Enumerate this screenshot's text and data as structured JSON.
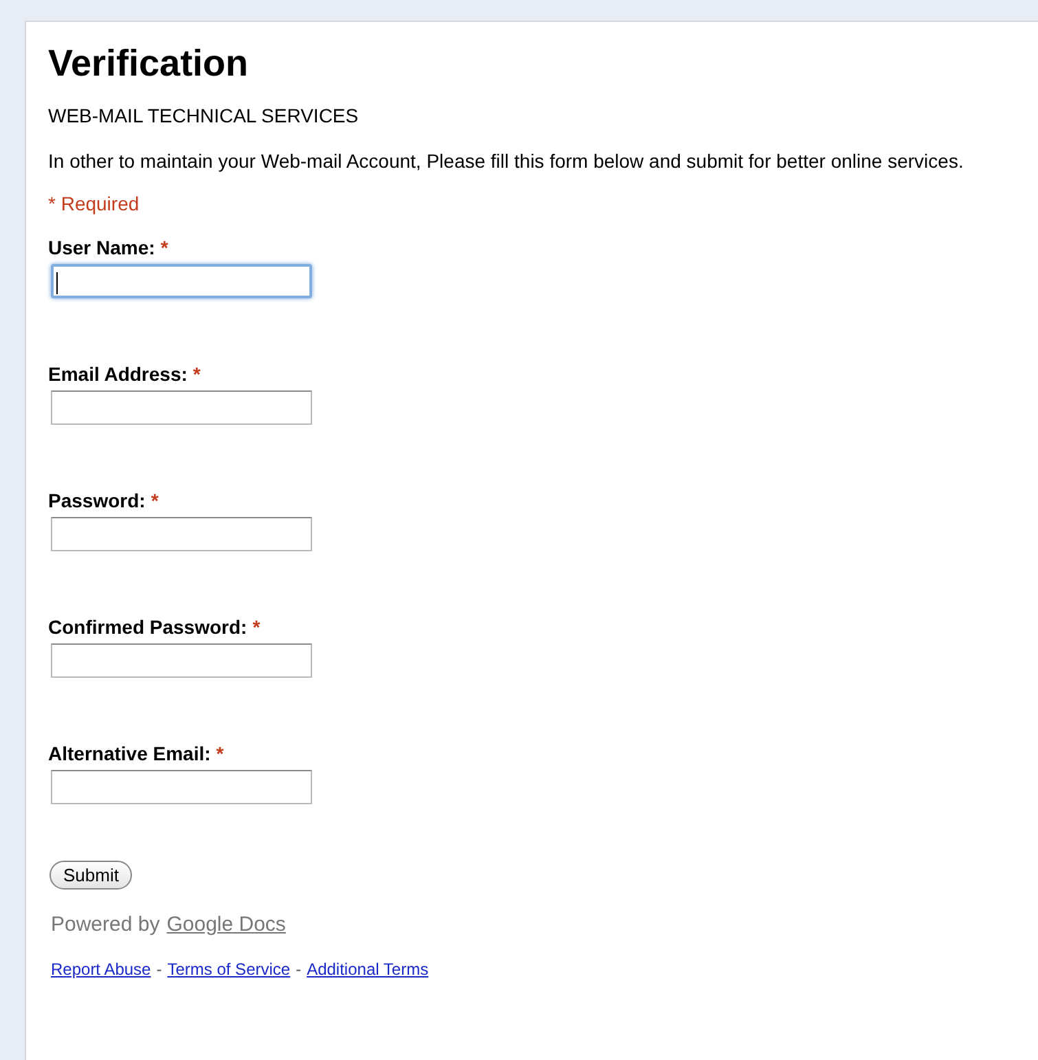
{
  "title": "Verification",
  "subtitle": "WEB-MAIL TECHNICAL SERVICES",
  "description": "In other to maintain your Web-mail Account, Please fill this form below and submit for better online services.",
  "required_note": "* Required",
  "fields": [
    {
      "label": "User Name:",
      "required_mark": "*",
      "focused": true
    },
    {
      "label": "Email Address:",
      "required_mark": "*",
      "focused": false
    },
    {
      "label": "Password:",
      "required_mark": "*",
      "focused": false
    },
    {
      "label": "Confirmed Password:",
      "required_mark": "*",
      "focused": false
    },
    {
      "label": "Alternative Email:",
      "required_mark": "*",
      "focused": false
    }
  ],
  "submit_button": "Submit",
  "powered_by": {
    "text": "Powered by",
    "link": "Google Docs"
  },
  "footer_links": [
    {
      "label": "Report Abuse",
      "separator": "-"
    },
    {
      "label": "Terms of Service",
      "separator": "-"
    },
    {
      "label": "Additional Terms"
    }
  ]
}
